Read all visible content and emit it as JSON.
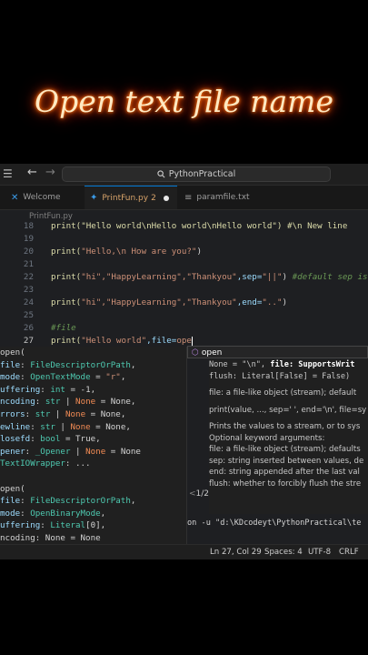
{
  "overlay_title": "Open text file name",
  "titlebar": {
    "menu_icon": "menu-icon",
    "back_icon": "arrow-left-icon",
    "forward_icon": "arrow-right-icon",
    "search_text": "PythonPractical"
  },
  "tabs": [
    {
      "label": "Welcome",
      "icon": "vscode-icon"
    },
    {
      "label": "PrintFun.py",
      "badge": "2",
      "icon": "python-icon"
    },
    {
      "label": "paramfile.txt",
      "icon": "text-file-icon"
    }
  ],
  "breadcrumb": "PrintFun.py",
  "lines": {
    "l18": {
      "num": "18",
      "text": "print(\"Hello world\\nHello world\\nHello world\") #\\n New line"
    },
    "l19": {
      "num": "19"
    },
    "l20": {
      "num": "20",
      "a": "print(",
      "b": "\"Hello,\\n How are you?\"",
      "c": ")"
    },
    "l21": {
      "num": "21"
    },
    "l22": {
      "num": "22",
      "a": "print(",
      "b": "\"hi\",\"HappyLearning\",\"Thankyou\"",
      "c": ",sep=",
      "d": "\"||\"",
      "e": ") ",
      "f": "#default sep is"
    },
    "l23": {
      "num": "23"
    },
    "l24": {
      "num": "24",
      "a": "print(",
      "b": "\"hi\",\"HappyLearning\",\"Thankyou\"",
      "c": ",end=",
      "d": "\"..\"",
      "e": ")"
    },
    "l25": {
      "num": "25"
    },
    "l26": {
      "num": "26",
      "text": "#file"
    },
    "l27": {
      "num": "27",
      "a": "print(",
      "b": "\"Hello world\"",
      "c": ",file=",
      "d": "ope"
    }
  },
  "suggestion": {
    "icon": "cube-icon",
    "text": "open"
  },
  "signature": {
    "s1": "open(",
    "s2a": "file",
    "s2b": ": ",
    "s2c": "FileDescriptorOrPath",
    "s3a": "mode",
    "s3b": ": ",
    "s3c": "OpenTextMode",
    "s3d": " = ",
    "s3e": "\"r\"",
    "s4a": "uffering",
    "s4b": ": ",
    "s4c": "int",
    "s4d": " = -1,",
    "s5a": "ncoding",
    "s5b": ": ",
    "s5c": "str",
    "s5d": " | ",
    "s5e": "None",
    "s5f": " = None,",
    "s6a": "rrors",
    "s6b": ": ",
    "s6c": "str",
    "s6d": " | ",
    "s6e": "None",
    "s6f": " = None,",
    "s7a": "ewline",
    "s7b": ": ",
    "s7c": "str",
    "s7d": " | ",
    "s7e": "None",
    "s7f": " = None,",
    "s8a": "losefd",
    "s8b": ": ",
    "s8c": "bool",
    "s8d": " = True,",
    "s9a": "pener",
    "s9b": ": ",
    "s9c": "_Opener",
    "s9d": " | ",
    "s9e": "None",
    "s9f": " = None",
    "s10a": "TextIOWrapper",
    "s10b": ": ...",
    "s11": "open(",
    "s12a": "file",
    "s12b": ": ",
    "s12c": "FileDescriptorOrPath",
    "s13a": "mode",
    "s13b": ": ",
    "s13c": "OpenBinaryMode",
    "s13d": ",",
    "s14a": "uffering",
    "s14b": ": ",
    "s14c": "Literal",
    "s14d": "[0],",
    "s15": "ncoding: None = None"
  },
  "docs": {
    "d1a": "None = \"\\n\", ",
    "d1b": "file: SupportsWrit",
    "d2": "flush: Literal[False] = False)",
    "d3": "file:  a file-like object (stream); default",
    "d4": "print(value, ..., sep=' ', end='\\n', file=sy",
    "d5": "Prints the values to a stream, or to sys",
    "d6": "Optional keyword arguments:",
    "d7": "file: a file-like object (stream); defaults",
    "d8": "sep: string inserted between values, de",
    "d9": "end: string appended after the last val",
    "d10": "flush: whether to forcibly flush the stre"
  },
  "pager": "1/2",
  "terminal": "on -u \"d:\\KDcodeyt\\PythonPractical\\te",
  "status": {
    "position": "Ln 27, Col 29",
    "spaces": "Spaces: 4",
    "encoding": "UTF-8",
    "eol": "CRLF"
  },
  "colors": {
    "accent": "#0078d4",
    "glow": "#ff5a00"
  }
}
